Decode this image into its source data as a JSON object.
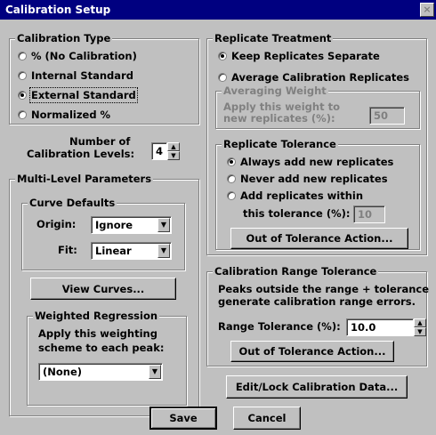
{
  "window": {
    "title": "Calibration Setup",
    "close_glyph": "×"
  },
  "calibration_type": {
    "legend": "Calibration Type",
    "options": [
      "% (No Calibration)",
      "Internal Standard",
      "External Standard",
      "Normalized %"
    ],
    "selected": "External Standard"
  },
  "levels": {
    "label_line1": "Number of",
    "label_line2": "Calibration Levels:",
    "value": "4"
  },
  "multi_level": {
    "legend": "Multi-Level Parameters",
    "curve_defaults": {
      "legend": "Curve Defaults",
      "origin_label": "Origin:",
      "origin_value": "Ignore",
      "fit_label": "Fit:",
      "fit_value": "Linear"
    },
    "view_curves_button": "View Curves...",
    "weighted": {
      "legend": "Weighted Regression",
      "desc_line1": "Apply this weighting",
      "desc_line2": "scheme to each peak:",
      "value": "(None)"
    }
  },
  "replicate_treatment": {
    "legend": "Replicate Treatment",
    "keep_separate": "Keep Replicates Separate",
    "average": "Average Calibration Replicates",
    "selected": "Keep Replicates Separate",
    "averaging_weight": {
      "legend": "Averaging Weight",
      "desc_line1": "Apply this weight to",
      "desc_line2": "new replicates (%):",
      "value": "50"
    },
    "replicate_tolerance": {
      "legend": "Replicate Tolerance",
      "options": [
        "Always add new replicates",
        "Never add new replicates",
        "Add replicates within"
      ],
      "selected": "Always add new replicates",
      "tolerance_label": "this tolerance (%):",
      "tolerance_value": "10",
      "action_button": "Out of Tolerance Action..."
    }
  },
  "range_tolerance": {
    "legend": "Calibration Range Tolerance",
    "desc_line1": "Peaks outside the range + tolerance",
    "desc_line2": "generate calibration range errors.",
    "label": "Range Tolerance (%):",
    "value": "10.0",
    "action_button": "Out of Tolerance Action..."
  },
  "edit_lock_button": "Edit/Lock Calibration Data...",
  "save_button": "Save",
  "cancel_button": "Cancel"
}
